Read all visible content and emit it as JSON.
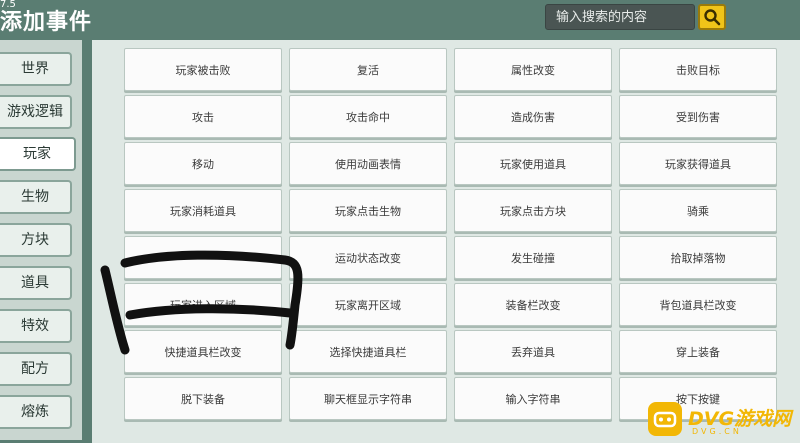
{
  "version": "7.5",
  "header": {
    "title": "添加事件",
    "search_placeholder": "输入搜索的内容"
  },
  "sidebar": {
    "items": [
      {
        "label": "世界"
      },
      {
        "label": "游戏逻辑"
      },
      {
        "label": "玩家",
        "active": true
      },
      {
        "label": "生物"
      },
      {
        "label": "方块"
      },
      {
        "label": "道具"
      },
      {
        "label": "特效"
      },
      {
        "label": "配方"
      },
      {
        "label": "熔炼"
      }
    ]
  },
  "events": [
    "玩家被击败",
    "复活",
    "属性改变",
    "击败目标",
    "攻击",
    "攻击命中",
    "造成伤害",
    "受到伤害",
    "移动",
    "使用动画表情",
    "玩家使用道具",
    "玩家获得道具",
    "玩家消耗道具",
    "玩家点击生物",
    "玩家点击方块",
    "骑乘",
    "",
    "运动状态改变",
    "发生碰撞",
    "拾取掉落物",
    "玩家进入区域",
    "玩家离开区域",
    "装备栏改变",
    "背包道具栏改变",
    "快捷道具栏改变",
    "选择快捷道具栏",
    "丢弃道具",
    "穿上装备",
    "脱下装备",
    "聊天框显示字符串",
    "输入字符串",
    "按下按键"
  ],
  "watermark": {
    "text": "DVG游戏网",
    "sub": "DVG.CN"
  },
  "colors": {
    "accent": "#f0c419",
    "sidebar_bg": "#c9d6d0",
    "panel_bg": "#dfe8e4",
    "scribble": "#111111"
  }
}
